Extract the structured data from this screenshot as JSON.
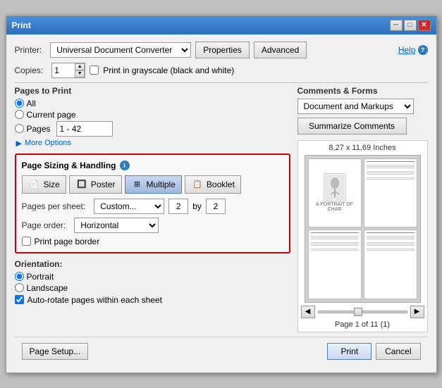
{
  "window": {
    "title": "Print"
  },
  "header": {
    "help_label": "Help",
    "printer_label": "Printer:",
    "printer_value": "Universal Document Converter",
    "properties_label": "Properties",
    "advanced_label": "Advanced",
    "copies_label": "Copies:",
    "copies_value": "1",
    "grayscale_label": "Print in grayscale (black and white)"
  },
  "pages_to_print": {
    "title": "Pages to Print",
    "all_label": "All",
    "current_page_label": "Current page",
    "pages_label": "Pages",
    "pages_value": "1 - 42",
    "more_options_label": "More Options"
  },
  "page_sizing": {
    "title": "Page Sizing & Handling",
    "size_label": "Size",
    "poster_label": "Poster",
    "multiple_label": "Multiple",
    "booklet_label": "Booklet",
    "pages_per_sheet_label": "Pages per sheet:",
    "pages_per_sheet_value": "Custom...",
    "by_label": "by",
    "x_value": "2",
    "y_value": "2",
    "page_order_label": "Page order:",
    "page_order_value": "Horizontal",
    "print_border_label": "Print page border"
  },
  "orientation": {
    "title": "Orientation:",
    "portrait_label": "Portrait",
    "landscape_label": "Landscape",
    "auto_rotate_label": "Auto-rotate pages within each sheet"
  },
  "comments_forms": {
    "title": "Comments & Forms",
    "value": "Document and Markups",
    "summarize_label": "Summarize Comments"
  },
  "preview": {
    "size_label": "8,27 x 11,69 Inches",
    "page_label": "Page 1 of 11 (1)"
  },
  "bottom": {
    "page_setup_label": "Page Setup...",
    "print_label": "Print",
    "cancel_label": "Cancel"
  },
  "icons": {
    "size_icon": "📄",
    "poster_icon": "🔲",
    "multiple_icon": "⊞",
    "booklet_icon": "📋"
  }
}
